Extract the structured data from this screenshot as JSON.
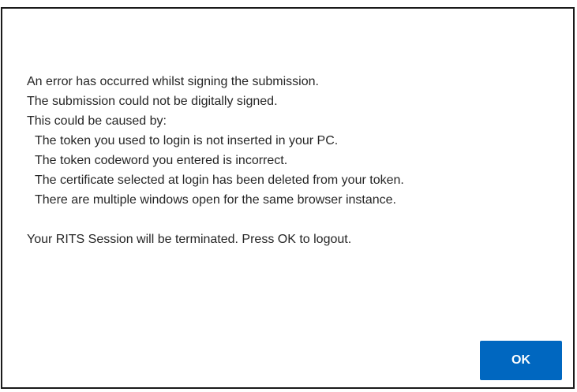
{
  "dialog": {
    "lines": [
      "An error has occurred whilst signing the submission.",
      "The submission could not be digitally signed.",
      "This could be caused by:"
    ],
    "causes": [
      "The token you used to login is not inserted in your PC.",
      "The token codeword you entered is incorrect.",
      "The certificate selected at login has been deleted from your token.",
      "There are multiple windows open for the same browser instance."
    ],
    "footer": "Your RITS Session will be terminated. Press OK to logout.",
    "ok_label": "OK",
    "accent_color": "#0067c0"
  }
}
